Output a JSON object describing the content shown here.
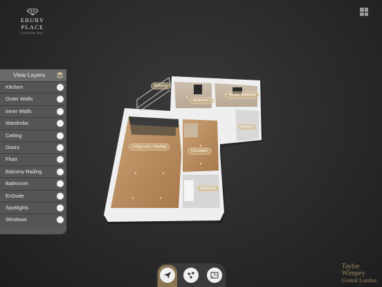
{
  "brand": {
    "name": "EBURY PLACE",
    "sub": "LONDON SW1"
  },
  "layers_panel": {
    "title": "View Layers",
    "items": [
      {
        "label": "Kitchen"
      },
      {
        "label": "Outer Walls"
      },
      {
        "label": "Inner Walls"
      },
      {
        "label": "Wardrobe"
      },
      {
        "label": "Ceiling"
      },
      {
        "label": "Doors"
      },
      {
        "label": "Floor"
      },
      {
        "label": "Balcony Railing"
      },
      {
        "label": "Bathroom"
      },
      {
        "label": "EnSuite"
      },
      {
        "label": "Spotlights"
      },
      {
        "label": "Windows"
      }
    ]
  },
  "rooms": {
    "balcony": "Balcony",
    "bedroom2": "Bedroom 2",
    "master": "Master Bedroom",
    "ensuite": "Ensuite",
    "living": "Living room / Kitchen",
    "circulation": "Circulation",
    "bathroom": "Bathroom"
  },
  "developer": {
    "line1": "Taylor",
    "line2": "Wimpey",
    "line3": "Central London"
  },
  "colors": {
    "accent": "#8a7650",
    "label_bg": "#d2b482"
  },
  "icons": {
    "toolbar": [
      "paper-plane-icon",
      "hotspots-icon",
      "floorplan-icon"
    ]
  }
}
